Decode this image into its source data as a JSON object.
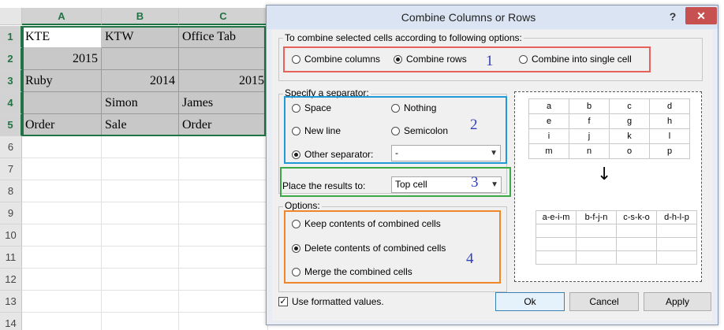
{
  "sheet": {
    "columns": [
      "A",
      "B",
      "C"
    ],
    "rows": [
      "1",
      "2",
      "3",
      "4",
      "5",
      "6",
      "7",
      "8",
      "9",
      "10",
      "11",
      "12",
      "13",
      "14"
    ],
    "cells": [
      [
        "KTE",
        "KTW",
        "Office Tab"
      ],
      [
        "2015",
        "",
        ""
      ],
      [
        "Ruby",
        "2014",
        "2015"
      ],
      [
        "",
        "Simon",
        "James"
      ],
      [
        "Order",
        "Sale",
        "Order"
      ]
    ]
  },
  "dialog": {
    "title": "Combine Columns or Rows",
    "help": "?",
    "close": "✕",
    "combine_group_label": "To combine selected cells according to following options:",
    "combine_options": [
      {
        "label": "Combine columns",
        "selected": false
      },
      {
        "label": "Combine rows",
        "selected": true
      },
      {
        "label": "Combine into single cell",
        "selected": false
      }
    ],
    "separator_group_label": "Specify a separator:",
    "separator_options": [
      {
        "label": "Space",
        "selected": false
      },
      {
        "label": "Nothing",
        "selected": false
      },
      {
        "label": "New line",
        "selected": false
      },
      {
        "label": "Semicolon",
        "selected": false
      },
      {
        "label": "Other separator:",
        "selected": true
      }
    ],
    "other_separator_value": "-",
    "place_label": "Place the results to:",
    "place_value": "Top cell",
    "options_group_label": "Options:",
    "options": [
      {
        "label": "Keep contents of combined cells",
        "selected": false
      },
      {
        "label": "Delete contents of combined cells",
        "selected": true
      },
      {
        "label": "Merge the combined cells",
        "selected": false
      }
    ],
    "use_formatted_label": "Use formatted values.",
    "use_formatted_checked": true,
    "buttons": {
      "ok": "Ok",
      "cancel": "Cancel",
      "apply": "Apply"
    },
    "markers": [
      "1",
      "2",
      "3",
      "4"
    ],
    "preview_grid": [
      [
        "a",
        "b",
        "c",
        "d"
      ],
      [
        "e",
        "f",
        "g",
        "h"
      ],
      [
        "i",
        "j",
        "k",
        "l"
      ],
      [
        "m",
        "n",
        "o",
        "p"
      ]
    ],
    "preview_arrow": "↓",
    "preview_result": [
      "a-e-i-m",
      "b-f-j-n",
      "c-s-k-o",
      "d-h-l-p"
    ]
  },
  "colors": {
    "highlight_1": "#e8605a",
    "highlight_2": "#1f9ad6",
    "highlight_3": "#3aa845",
    "highlight_4": "#f0852a",
    "marker": "#2e3fb8",
    "selection_border": "#217346"
  }
}
